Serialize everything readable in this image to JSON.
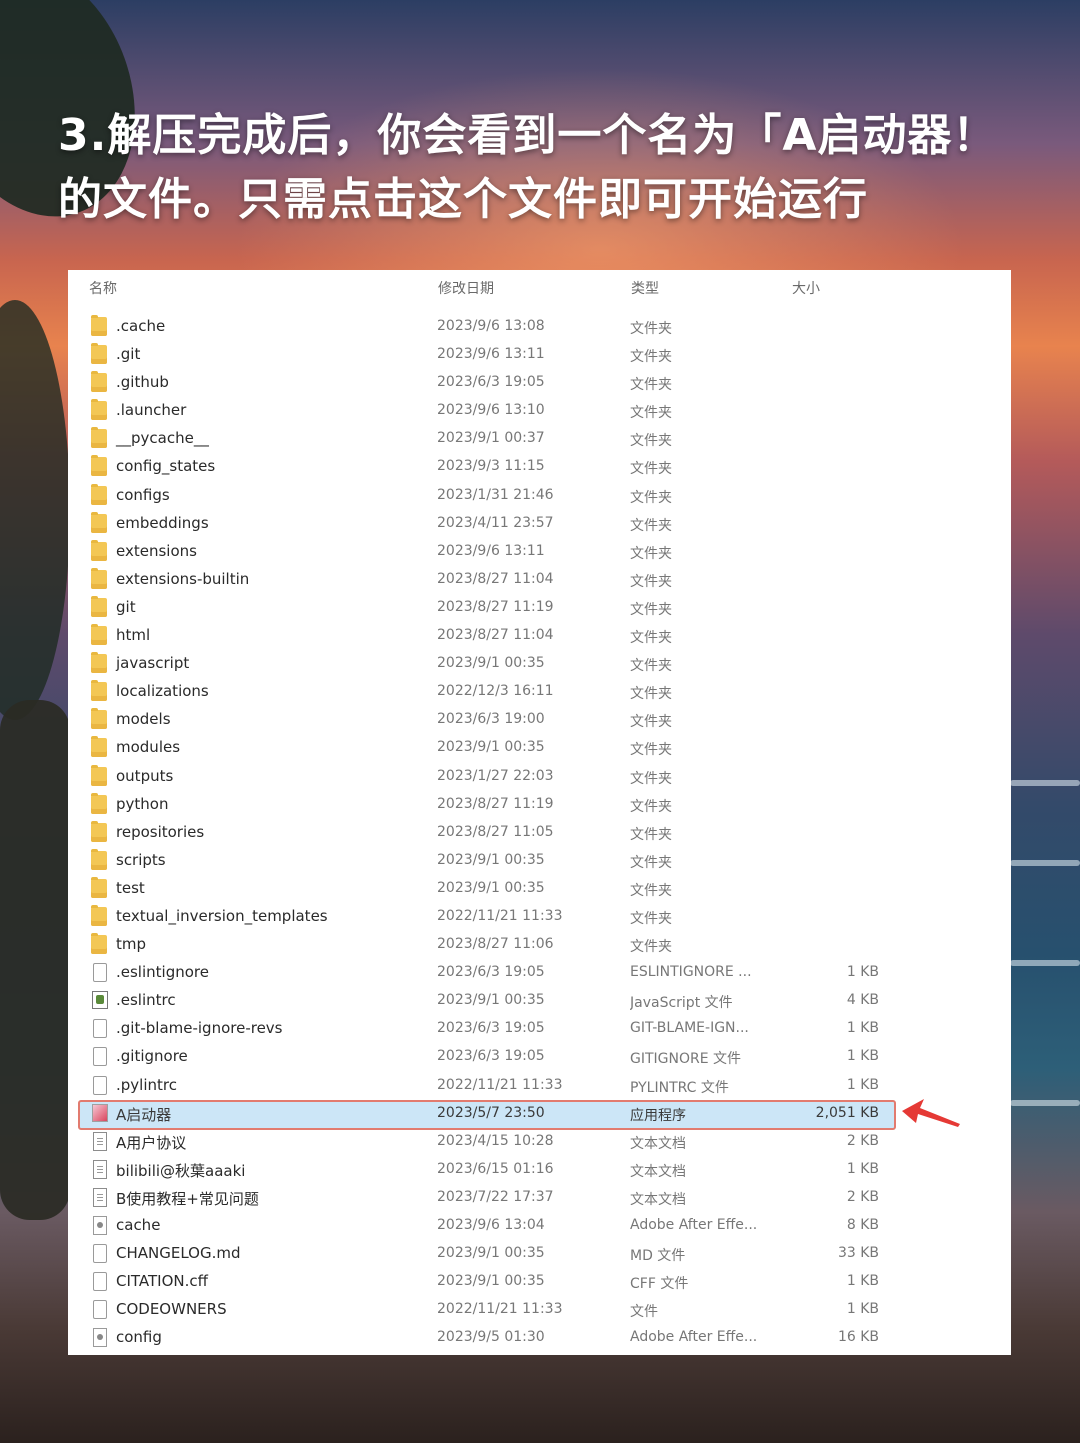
{
  "caption": {
    "line1": "3.解压完成后，你会看到一个名为「A启动器！",
    "line2": "的文件。只需点击这个文件即可开始运行"
  },
  "explorer": {
    "columns": {
      "name": "名称",
      "date": "修改日期",
      "type": "类型",
      "size": "大小"
    },
    "files": [
      {
        "name": ".cache",
        "date": "2023/9/6 13:08",
        "type": "文件夹",
        "size": "",
        "icon": "folder-icon"
      },
      {
        "name": ".git",
        "date": "2023/9/6 13:11",
        "type": "文件夹",
        "size": "",
        "icon": "folder-icon"
      },
      {
        "name": ".github",
        "date": "2023/6/3 19:05",
        "type": "文件夹",
        "size": "",
        "icon": "folder-icon"
      },
      {
        "name": ".launcher",
        "date": "2023/9/6 13:10",
        "type": "文件夹",
        "size": "",
        "icon": "folder-icon"
      },
      {
        "name": "__pycache__",
        "date": "2023/9/1 00:37",
        "type": "文件夹",
        "size": "",
        "icon": "folder-icon"
      },
      {
        "name": "config_states",
        "date": "2023/9/3 11:15",
        "type": "文件夹",
        "size": "",
        "icon": "folder-icon"
      },
      {
        "name": "configs",
        "date": "2023/1/31 21:46",
        "type": "文件夹",
        "size": "",
        "icon": "folder-icon"
      },
      {
        "name": "embeddings",
        "date": "2023/4/11 23:57",
        "type": "文件夹",
        "size": "",
        "icon": "folder-icon"
      },
      {
        "name": "extensions",
        "date": "2023/9/6 13:11",
        "type": "文件夹",
        "size": "",
        "icon": "folder-icon"
      },
      {
        "name": "extensions-builtin",
        "date": "2023/8/27 11:04",
        "type": "文件夹",
        "size": "",
        "icon": "folder-icon"
      },
      {
        "name": "git",
        "date": "2023/8/27 11:19",
        "type": "文件夹",
        "size": "",
        "icon": "folder-icon"
      },
      {
        "name": "html",
        "date": "2023/8/27 11:04",
        "type": "文件夹",
        "size": "",
        "icon": "folder-icon"
      },
      {
        "name": "javascript",
        "date": "2023/9/1 00:35",
        "type": "文件夹",
        "size": "",
        "icon": "folder-icon"
      },
      {
        "name": "localizations",
        "date": "2022/12/3 16:11",
        "type": "文件夹",
        "size": "",
        "icon": "folder-icon"
      },
      {
        "name": "models",
        "date": "2023/6/3 19:00",
        "type": "文件夹",
        "size": "",
        "icon": "folder-icon"
      },
      {
        "name": "modules",
        "date": "2023/9/1 00:35",
        "type": "文件夹",
        "size": "",
        "icon": "folder-icon"
      },
      {
        "name": "outputs",
        "date": "2023/1/27 22:03",
        "type": "文件夹",
        "size": "",
        "icon": "folder-icon"
      },
      {
        "name": "python",
        "date": "2023/8/27 11:19",
        "type": "文件夹",
        "size": "",
        "icon": "folder-icon"
      },
      {
        "name": "repositories",
        "date": "2023/8/27 11:05",
        "type": "文件夹",
        "size": "",
        "icon": "folder-icon"
      },
      {
        "name": "scripts",
        "date": "2023/9/1 00:35",
        "type": "文件夹",
        "size": "",
        "icon": "folder-icon"
      },
      {
        "name": "test",
        "date": "2023/9/1 00:35",
        "type": "文件夹",
        "size": "",
        "icon": "folder-icon"
      },
      {
        "name": "textual_inversion_templates",
        "date": "2022/11/21 11:33",
        "type": "文件夹",
        "size": "",
        "icon": "folder-icon"
      },
      {
        "name": "tmp",
        "date": "2023/8/27 11:06",
        "type": "文件夹",
        "size": "",
        "icon": "folder-icon"
      },
      {
        "name": ".eslintignore",
        "date": "2023/6/3 19:05",
        "type": "ESLINTIGNORE ...",
        "size": "1 KB",
        "icon": "file-icon"
      },
      {
        "name": ".eslintrc",
        "date": "2023/9/1 00:35",
        "type": "JavaScript 文件",
        "size": "4 KB",
        "icon": "script-icon"
      },
      {
        "name": ".git-blame-ignore-revs",
        "date": "2023/6/3 19:05",
        "type": "GIT-BLAME-IGN...",
        "size": "1 KB",
        "icon": "file-icon"
      },
      {
        "name": ".gitignore",
        "date": "2023/6/3 19:05",
        "type": "GITIGNORE 文件",
        "size": "1 KB",
        "icon": "file-icon"
      },
      {
        "name": ".pylintrc",
        "date": "2022/11/21 11:33",
        "type": "PYLINTRC 文件",
        "size": "1 KB",
        "icon": "file-icon"
      },
      {
        "name": "A启动器",
        "date": "2023/5/7 23:50",
        "type": "应用程序",
        "size": "2,051 KB",
        "icon": "app-icon",
        "selected": true
      },
      {
        "name": "A用户协议",
        "date": "2023/4/15 10:28",
        "type": "文本文档",
        "size": "2 KB",
        "icon": "doc-icon"
      },
      {
        "name": "bilibili@秋葉aaaki",
        "date": "2023/6/15 01:16",
        "type": "文本文档",
        "size": "1 KB",
        "icon": "doc-icon"
      },
      {
        "name": "B使用教程+常见问题",
        "date": "2023/7/22 17:37",
        "type": "文本文档",
        "size": "2 KB",
        "icon": "doc-icon"
      },
      {
        "name": "cache",
        "date": "2023/9/6 13:04",
        "type": "Adobe After Effe...",
        "size": "8 KB",
        "icon": "gear-file-icon"
      },
      {
        "name": "CHANGELOG.md",
        "date": "2023/9/1 00:35",
        "type": "MD 文件",
        "size": "33 KB",
        "icon": "file-icon"
      },
      {
        "name": "CITATION.cff",
        "date": "2023/9/1 00:35",
        "type": "CFF 文件",
        "size": "1 KB",
        "icon": "file-icon"
      },
      {
        "name": "CODEOWNERS",
        "date": "2022/11/21 11:33",
        "type": "文件",
        "size": "1 KB",
        "icon": "file-icon"
      },
      {
        "name": "config",
        "date": "2023/9/5 01:30",
        "type": "Adobe After Effe...",
        "size": "16 KB",
        "icon": "gear-file-icon"
      }
    ]
  },
  "colors": {
    "highlight_fill": "#cce6f7",
    "highlight_border": "#e27b6f",
    "arrow": "#e53935"
  }
}
